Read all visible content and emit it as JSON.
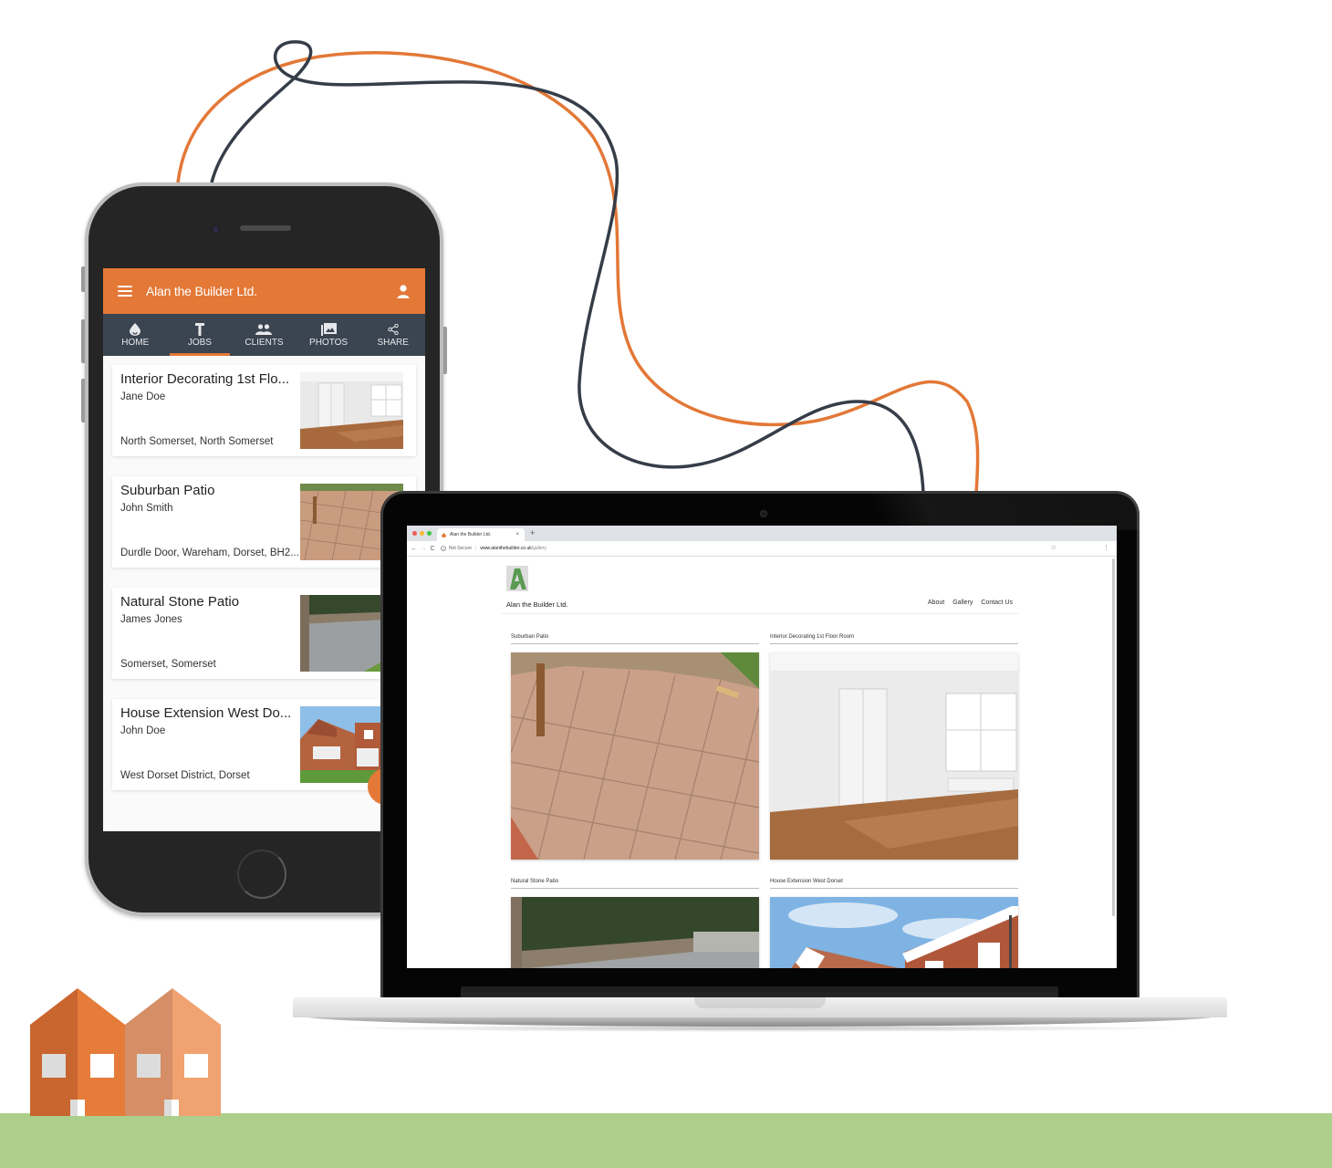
{
  "colors": {
    "brand_orange": "#e37837",
    "nav_slate": "#3b4451",
    "cable_dark": "#353d48",
    "ground_green": "#accf8b",
    "logo_green": "#5a9a52"
  },
  "phone_app": {
    "title": "Alan the Builder Ltd.",
    "menu_icon": "hamburger-menu-icon",
    "account_icon": "account-person-icon",
    "tabs": [
      {
        "label": "HOME",
        "icon": "home-drop-icon",
        "active": false
      },
      {
        "label": "JOBS",
        "icon": "hammer-icon",
        "active": true
      },
      {
        "label": "CLIENTS",
        "icon": "people-icon",
        "active": false
      },
      {
        "label": "PHOTOS",
        "icon": "photo-library-icon",
        "active": false
      },
      {
        "label": "SHARE",
        "icon": "share-icon",
        "active": false
      }
    ],
    "jobs": [
      {
        "title": "Interior Decorating 1st Flo...",
        "client": "Jane Doe",
        "location": "North Somerset, North Somerset",
        "thumb": "room-photo"
      },
      {
        "title": "Suburban Patio",
        "client": "John Smith",
        "location": "Durdle Door, Wareham, Dorset, BH2...",
        "thumb": "patio-photo"
      },
      {
        "title": "Natural Stone Patio",
        "client": "James Jones",
        "location": "Somerset, Somerset",
        "thumb": "stone-patio-photo"
      },
      {
        "title": "House Extension West Do...",
        "client": "John Doe",
        "location": "West Dorset District, Dorset",
        "thumb": "house-photo"
      }
    ]
  },
  "browser": {
    "tab_title": "Alan the Builder Ltd.",
    "tab_close": "×",
    "new_tab": "+",
    "back": "←",
    "forward": "→",
    "reload": "C",
    "security_label": "Not Secure",
    "url_host": "www.alanthebuilder.co.uk",
    "url_path": "/gallery",
    "bookmark_icon": "☆",
    "menu_icon": "⋮"
  },
  "website": {
    "logo_letter": "A",
    "site_name": "Alan the Builder Ltd.",
    "nav": [
      "About",
      "Gallery",
      "Contact Us"
    ],
    "gallery": [
      {
        "label": "Suburban Patio",
        "image": "patio-photo"
      },
      {
        "label": "Interior Decorating 1st Floor Room",
        "image": "room-photo"
      },
      {
        "label": "Natural Stone Patio",
        "image": "stone-patio-photo"
      },
      {
        "label": "House Extension West Dorset",
        "image": "house-photo"
      }
    ]
  }
}
